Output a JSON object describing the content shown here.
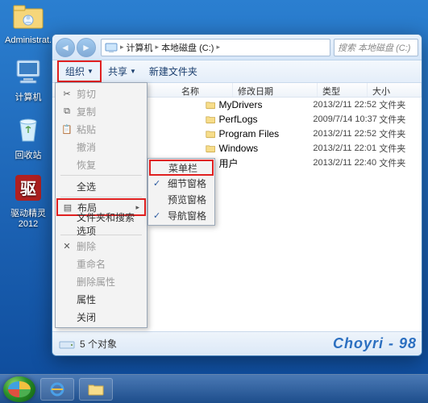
{
  "desktop": {
    "icons": [
      {
        "label": "Administrat..."
      },
      {
        "label": "计算机"
      },
      {
        "label": "回收站"
      },
      {
        "label": "驱动精灵\n2012"
      }
    ]
  },
  "explorer": {
    "breadcrumb": {
      "computer": "计算机",
      "drive": "本地磁盘 (C:)"
    },
    "search_placeholder": "搜索 本地磁盘 (C:)",
    "toolbar": {
      "organize": "组织",
      "share": "共享",
      "newfolder": "新建文件夹"
    },
    "columns": {
      "name": "名称",
      "date": "修改日期",
      "type": "类型",
      "size": "大小"
    },
    "files": [
      {
        "name": "MyDrivers",
        "date": "2013/2/11 22:52",
        "type": "文件夹"
      },
      {
        "name": "PerfLogs",
        "date": "2009/7/14 10:37",
        "type": "文件夹"
      },
      {
        "name": "Program Files",
        "date": "2013/2/11 22:52",
        "type": "文件夹"
      },
      {
        "name": "Windows",
        "date": "2013/2/11 22:01",
        "type": "文件夹"
      },
      {
        "name": "用户",
        "date": "2013/2/11 22:40",
        "type": "文件夹"
      }
    ],
    "status": "5 个对象",
    "watermark": "Choyri - 98"
  },
  "dropdown": {
    "items": {
      "cut": "剪切",
      "copy": "复制",
      "paste": "粘贴",
      "undo": "撤消",
      "redo": "恢复",
      "selectall": "全选",
      "layout": "布局",
      "folder_opts": "文件夹和搜索选项",
      "delete": "删除",
      "rename": "重命名",
      "remove_props": "删除属性",
      "properties": "属性",
      "close": "关闭"
    }
  },
  "submenu": {
    "items": {
      "menubar": "菜单栏",
      "details": "细节窗格",
      "preview": "预览窗格",
      "navigation": "导航窗格"
    }
  }
}
